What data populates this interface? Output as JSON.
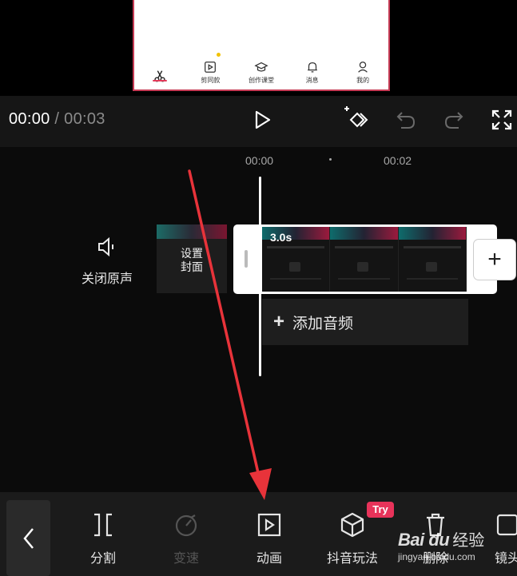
{
  "preview": {
    "nav": [
      {
        "label": "",
        "icon": "scissors-icon"
      },
      {
        "label": "剪同款",
        "icon": "template-icon"
      },
      {
        "label": "创作课堂",
        "icon": "graduation-cap-icon"
      },
      {
        "label": "消息",
        "icon": "bell-icon"
      },
      {
        "label": "我的",
        "icon": "user-icon"
      }
    ]
  },
  "controls": {
    "current_time": "00:00",
    "separator": " / ",
    "total_time": "00:03"
  },
  "timeline": {
    "ruler": [
      "00:00",
      "00:02"
    ],
    "mute_label": "关闭原声",
    "cover_label_line1": "设置",
    "cover_label_line2": "封面",
    "clip_duration": "3.0s",
    "add_clip": "+",
    "add_audio_plus": "+",
    "add_audio_label": "添加音频"
  },
  "toolbar": {
    "items": [
      {
        "label": "分割",
        "icon": "split-icon"
      },
      {
        "label": "变速",
        "icon": "speed-icon"
      },
      {
        "label": "动画",
        "icon": "animation-icon"
      },
      {
        "label": "抖音玩法",
        "icon": "cube-icon"
      },
      {
        "label": "删除",
        "icon": "trash-icon"
      },
      {
        "label": "镜头",
        "icon": "lens-icon"
      }
    ],
    "try_badge": "Try"
  },
  "watermark": {
    "logo": "Bai du",
    "suffix": "经验",
    "url": "jingyan.baidu.com"
  },
  "colors": {
    "accent": "#e23b5a",
    "annotation_red": "#e8333a",
    "frame_border": "#c63b55"
  }
}
